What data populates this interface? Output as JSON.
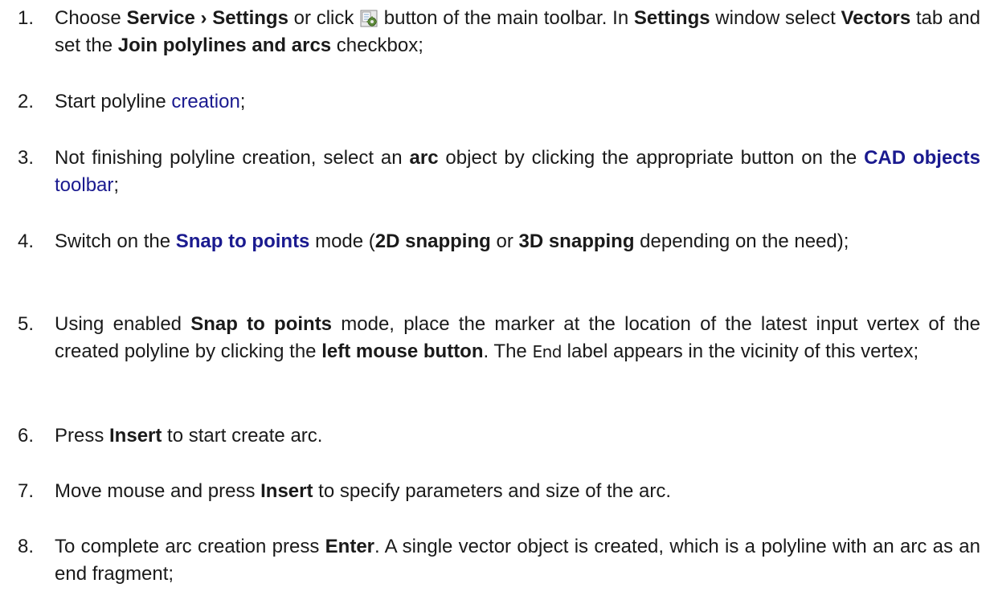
{
  "steps": [
    {
      "number": "1.",
      "t1": "Choose ",
      "b1": "Service › Settings",
      "t2": " or click ",
      "icon": "settings-gear-icon",
      "t3": " button of the main toolbar. In ",
      "b2": "Settings",
      "t4": " window select ",
      "b3": "Vectors",
      "t5": " tab and set the ",
      "b4": "Join polylines and arcs",
      "t6": " checkbox;"
    },
    {
      "number": "2.",
      "t1": "Start polyline ",
      "link": "creation",
      "t2": ";"
    },
    {
      "number": "3.",
      "t1": "Not finishing polyline creation, select an ",
      "b1": "arc",
      "t2": " object by clicking the appropriate button on the ",
      "link_bold": "CAD objects",
      "link": " toolbar",
      "t3": ";"
    },
    {
      "number": "4.",
      "t1": "Switch on the ",
      "link_bold": "Snap to points",
      "t2": " mode (",
      "b1": "2D snapping",
      "t3": " or ",
      "b2": "3D snapping",
      "t4": " depending on the need);"
    },
    {
      "number": "5.",
      "t1": "Using enabled ",
      "b1": "Snap to points",
      "t2": " mode, place the marker at the location of the latest input vertex of the created polyline by clicking the ",
      "b2": "left mouse button",
      "t3": ". The ",
      "label": "End",
      "t4": " label appears in the vicinity of this vertex;"
    },
    {
      "number": "6.",
      "t1": "Press ",
      "b1": "Insert",
      "t2": " to start create arc."
    },
    {
      "number": "7.",
      "t1": "Move mouse and press ",
      "b1": "Insert",
      "t2": " to specify parameters and size of the arc."
    },
    {
      "number": "8.",
      "t1": "To complete arc creation press ",
      "b1": "Enter",
      "t2": ". A single vector object is created, which is a polyline with an arc as an end fragment;"
    }
  ]
}
